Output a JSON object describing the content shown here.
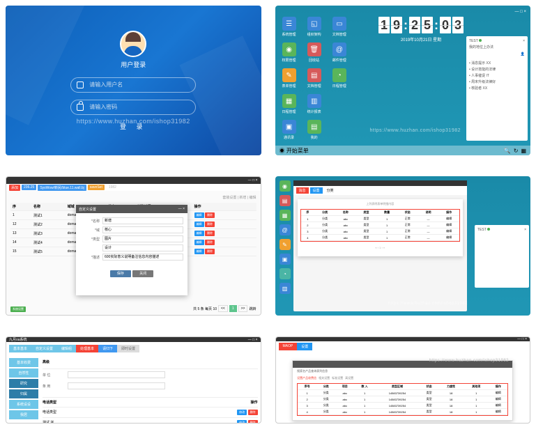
{
  "watermark": "https://www.huzhan.com/ishop31982",
  "login": {
    "title": "用户登录",
    "username_placeholder": "请输入用户名",
    "password_placeholder": "请输入密码",
    "button": "登 录"
  },
  "desktop": {
    "clock": [
      "1",
      "9",
      "2",
      "5",
      "0",
      "3"
    ],
    "date": "2019年10月21日 星期",
    "icons": [
      {
        "label": "系统管理",
        "color": "#3a86d6",
        "glyph": "☰"
      },
      {
        "label": "组织架构",
        "color": "#3a86d6",
        "glyph": "◱"
      },
      {
        "label": "文档管理",
        "color": "#3a86d6",
        "glyph": "▭"
      },
      {
        "label": "",
        "color": "",
        "glyph": ""
      },
      {
        "label": "权限管理",
        "color": "#5ab55a",
        "glyph": "◉"
      },
      {
        "label": "回收站",
        "color": "#d65a5a",
        "glyph": "🗑"
      },
      {
        "label": "邮件管理",
        "color": "#3a86d6",
        "glyph": "@"
      },
      {
        "label": "",
        "color": "",
        "glyph": ""
      },
      {
        "label": "表单管理",
        "color": "#f0a030",
        "glyph": "✎"
      },
      {
        "label": "文档管理",
        "color": "#d65a5a",
        "glyph": "▤"
      },
      {
        "label": "日程管理",
        "color": "#5ab55a",
        "glyph": "◔"
      },
      {
        "label": "",
        "color": "",
        "glyph": ""
      },
      {
        "label": "日程管理",
        "color": "#5ab55a",
        "glyph": "▦"
      },
      {
        "label": "统计报表",
        "color": "#3a86d6",
        "glyph": "▥"
      },
      {
        "label": "",
        "color": "",
        "glyph": ""
      },
      {
        "label": "",
        "color": "",
        "glyph": ""
      },
      {
        "label": "通讯录",
        "color": "#3a86d6",
        "glyph": "▣"
      },
      {
        "label": "我的",
        "color": "#5ab55a",
        "glyph": "▤"
      }
    ],
    "sidepanel": {
      "title": "TEST",
      "subtitle": "我的地位上办法",
      "items": [
        "消息提示 XX",
        "  设计技能的法律",
        "人事催促 IT",
        "  周末升级法律好",
        "核验者 XX"
      ]
    },
    "taskbar_start": "开始菜单"
  },
  "tablewin": {
    "colorbar": [
      {
        "text": "添加",
        "color": "#f44336"
      },
      {
        "text": "236.25",
        "color": "#4098f0"
      },
      {
        "text": "SysWow/新民/blue.11.wall.bj",
        "color": "#4098f0"
      },
      {
        "text": "saveSet",
        "color": "#f0a030"
      }
    ],
    "watermark_suffix": "1982",
    "breadcrumb": "套装设置 | 新增 | 编辑",
    "cols": [
      "序",
      "名称",
      "域域",
      "状态",
      "创建时间",
      "操作"
    ],
    "rows": [
      {
        "n": "1",
        "a": "测试1",
        "b": "domain",
        "t": "727",
        "d": "2019-10-21"
      },
      {
        "n": "12",
        "a": "测试2",
        "b": "domain",
        "t": "727",
        "d": "2019-10-21"
      },
      {
        "n": "13",
        "a": "测试3",
        "b": "domain",
        "t": "727",
        "d": "2019-10-21"
      },
      {
        "n": "14",
        "a": "测试4",
        "b": "domain",
        "t": "727",
        "d": "2019-10-21"
      },
      {
        "n": "15",
        "a": "测试5",
        "b": "domain",
        "t": "727",
        "d": "2019-10-21"
      }
    ],
    "dialog": {
      "title": "自定义设置",
      "fields": [
        {
          "label": "*名称",
          "value": "新增"
        },
        {
          "label": "*域",
          "value": "核心"
        },
        {
          "label": "*类型",
          "value": "图片"
        },
        {
          "label": "",
          "value": "设计"
        },
        {
          "label": "*描述",
          "value": "600实际意义说明备注信息内容描述"
        }
      ],
      "save": "保存",
      "close": "关闭"
    },
    "pagination": {
      "info": "共 5 条 每页 10",
      "pages": [
        "<<",
        "1",
        ">>"
      ],
      "goto": "跳转"
    },
    "bottom_tag": "系统设置"
  },
  "desk2": {
    "side_icons": [
      {
        "color": "#5ab55a",
        "glyph": "◉"
      },
      {
        "color": "#d65a5a",
        "glyph": "▤"
      },
      {
        "color": "#5ab55a",
        "glyph": "▦"
      },
      {
        "color": "#3a86d6",
        "glyph": "@"
      },
      {
        "color": "#f0a030",
        "glyph": "✎"
      },
      {
        "color": "#3a86d6",
        "glyph": "▣"
      },
      {
        "color": "#4ab5a5",
        "glyph": "◔"
      },
      {
        "color": "#3a86d6",
        "glyph": "▥"
      }
    ],
    "nested_tabs": [
      "消息",
      "设置",
      "分类"
    ],
    "subtitle": "上列表明表单明细内容",
    "cols": [
      "序",
      "分类",
      "名称",
      "类型",
      "数量",
      "状态",
      "说明",
      "操作"
    ],
    "rows": [
      [
        "1",
        "分类",
        "abc",
        "类型",
        "1",
        "正常",
        "—",
        "编辑"
      ],
      [
        "2",
        "分类",
        "abc",
        "类型",
        "1",
        "正常",
        "—",
        "编辑"
      ],
      [
        "3",
        "分类",
        "abc",
        "类型",
        "1",
        "正常",
        "—",
        "编辑"
      ],
      [
        "4",
        "分类",
        "abc",
        "类型",
        "1",
        "正常",
        "—",
        "编辑"
      ]
    ]
  },
  "settings": {
    "title": "九月oa系统",
    "tabs": [
      "基本基本",
      "自定义设置",
      "编辑组",
      "处理基本",
      "请归下",
      "即时设置"
    ],
    "side": [
      "基本收费",
      "自然性",
      "研究",
      "归属",
      "系统设设",
      "我居"
    ],
    "header": "高级",
    "fields": [
      {
        "label": "单 位"
      },
      {
        "label": "条 用"
      }
    ],
    "list_header": [
      "电话类型",
      "操作"
    ],
    "list": [
      "电话类型",
      "测试 字"
    ],
    "ops": [
      "修改",
      "删除"
    ]
  },
  "report": {
    "tabs": [
      "MAOP",
      "设置"
    ],
    "dialog_title": "MAOP 设一",
    "sub": "搜索名产品查询表列信息",
    "inner_tabs": [
      "设置产品收费信",
      "相关设置",
      "标准设置",
      "高设置"
    ],
    "cols": [
      "序号",
      "分类",
      "项目",
      "数 入",
      "类型区域",
      "状态",
      "力度性",
      "其他项",
      "操作"
    ],
    "rows": [
      [
        "1",
        "分类",
        "abc",
        "1",
        "14583739254",
        "类型",
        "18",
        "1",
        "编辑"
      ],
      [
        "2",
        "分类",
        "abc",
        "1",
        "14583739254",
        "类型",
        "18",
        "1",
        "编辑"
      ],
      [
        "3",
        "分类",
        "abc",
        "1",
        "14583739254",
        "类型",
        "18",
        "1",
        "编辑"
      ],
      [
        "4",
        "分类",
        "abc",
        "1",
        "14583739254",
        "类型",
        "18",
        "1",
        "编辑"
      ]
    ]
  }
}
